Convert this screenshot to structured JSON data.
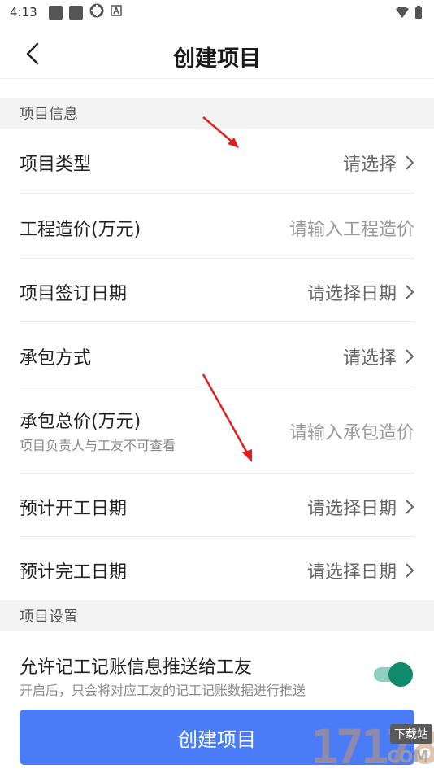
{
  "status_bar": {
    "time": "4:13",
    "icons": [
      "notification-icon",
      "notification-icon",
      "sync-icon",
      "app-a-icon"
    ],
    "right_icons": [
      "wifi-icon",
      "battery-icon"
    ]
  },
  "nav": {
    "title": "创建项目"
  },
  "sections": {
    "project_info": {
      "title": "项目信息"
    },
    "project_settings": {
      "title": "项目设置"
    }
  },
  "rows": {
    "project_type": {
      "label": "项目类型",
      "value": "请选择"
    },
    "engineering_cost": {
      "label": "工程造价(万元)",
      "placeholder": "请输入工程造价"
    },
    "sign_date": {
      "label": "项目签订日期",
      "value": "请选择日期"
    },
    "contract_method": {
      "label": "承包方式",
      "value": "请选择"
    },
    "contract_total": {
      "label": "承包总价(万元)",
      "sub": "项目负责人与工友不可查看",
      "placeholder": "请输入承包造价"
    },
    "start_date": {
      "label": "预计开工日期",
      "value": "请选择日期"
    },
    "end_date": {
      "label": "预计完工日期",
      "value": "请选择日期"
    }
  },
  "settings": {
    "push": {
      "label": "允许记工记账信息推送给工友",
      "sub": "开启后，只会将对应工友的记工记账数据进行推送",
      "enabled": true
    }
  },
  "button": {
    "create_label": "创建项目"
  },
  "watermark": {
    "number": "17178",
    "tag": "下载站",
    "suffix": "COM"
  },
  "colors": {
    "primary": "#4a7cf7",
    "toggle": "#0f8a6a",
    "arrow": "#e02020"
  }
}
